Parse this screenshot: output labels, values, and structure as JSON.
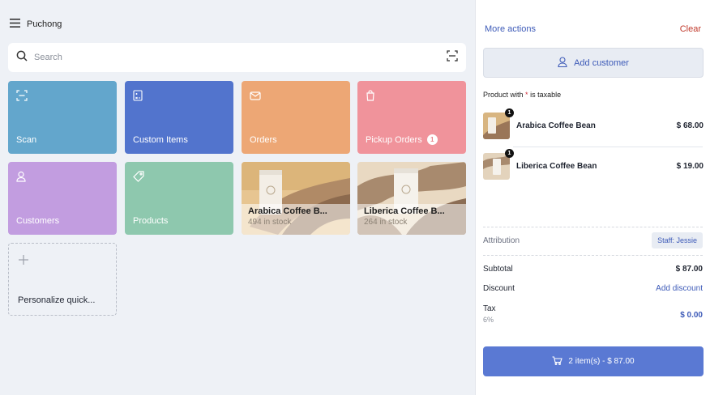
{
  "header": {
    "store": "Puchong",
    "menu_icon": "hamburger-menu-icon"
  },
  "search": {
    "placeholder": "Search",
    "icon": "search-icon",
    "scan_icon": "barcode-scan-icon"
  },
  "tiles": [
    {
      "label": "Scan",
      "color": "#63a6cc",
      "icon": "scan-icon"
    },
    {
      "label": "Custom Items",
      "color": "#5274cd",
      "icon": "calculator-icon"
    },
    {
      "label": "Orders",
      "color": "#eda775",
      "icon": "mail-icon"
    },
    {
      "label": "Pickup Orders",
      "color": "#f0939b",
      "icon": "bag-icon",
      "badge": "1"
    },
    {
      "label": "Customers",
      "color": "#c29de0",
      "icon": "person-icon"
    },
    {
      "label": "Products",
      "color": "#8ec8ae",
      "icon": "tag-icon"
    }
  ],
  "product_tiles": [
    {
      "name": "Arabica Coffee B...",
      "stock": "494 in stock"
    },
    {
      "name": "Liberica Coffee B...",
      "stock": "264 in stock"
    }
  ],
  "personalize": {
    "label": "Personalize quick...",
    "icon": "plus-icon"
  },
  "cart": {
    "more_actions": "More actions",
    "clear": "Clear",
    "add_customer": "Add customer",
    "tax_note_prefix": "Product with",
    "tax_note_star": "*",
    "tax_note_suffix": "is taxable",
    "items": [
      {
        "name": "Arabica Coffee Bean",
        "price": "$ 68.00",
        "qty": "1"
      },
      {
        "name": "Liberica Coffee Bean",
        "price": "$ 19.00",
        "qty": "1"
      }
    ],
    "attribution_label": "Attribution",
    "staff": "Staff: Jessie",
    "subtotal_label": "Subtotal",
    "subtotal": "$ 87.00",
    "discount_label": "Discount",
    "add_discount": "Add discount",
    "tax_label": "Tax",
    "tax_rate": "6%",
    "tax": "$ 0.00",
    "checkout": "2 item(s) - $ 87.00"
  }
}
